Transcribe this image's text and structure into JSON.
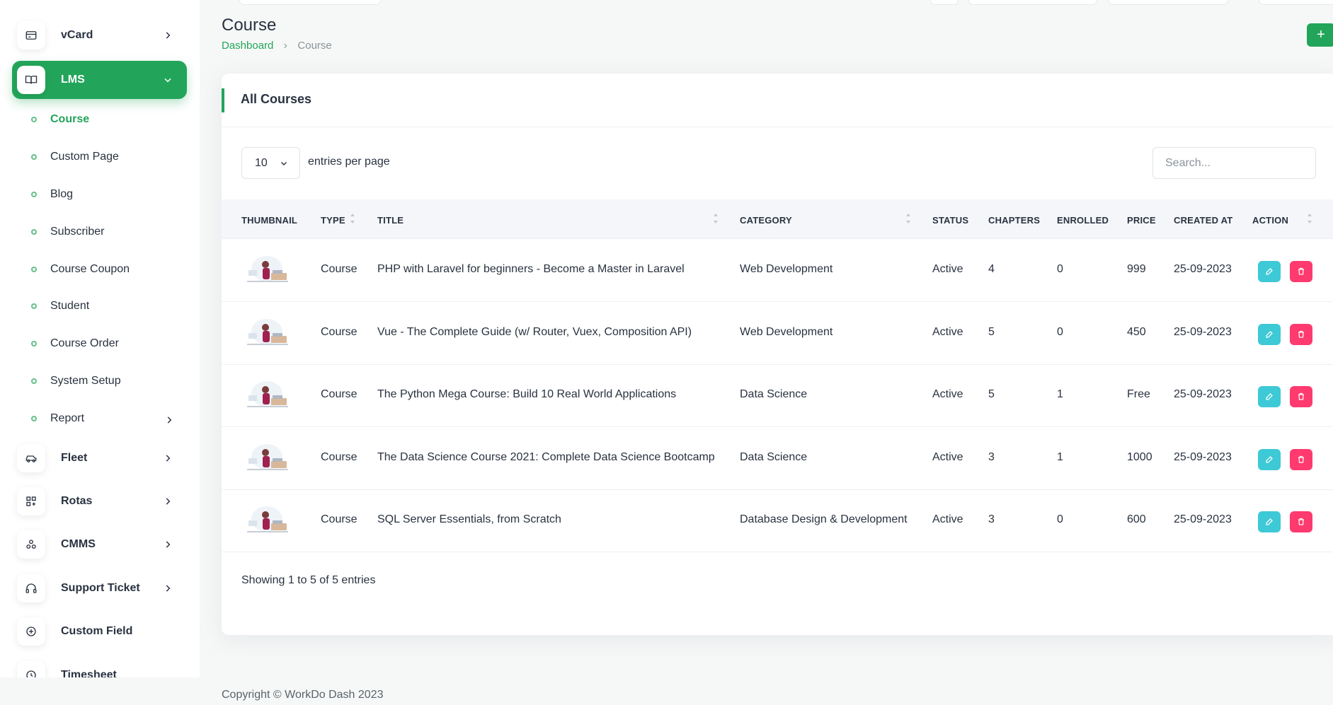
{
  "sidebar": {
    "items": [
      {
        "label": "vCard",
        "icon": "card-icon"
      },
      {
        "label": "LMS",
        "icon": "book-icon"
      },
      {
        "label": "Fleet",
        "icon": "car-icon"
      },
      {
        "label": "Rotas",
        "icon": "grid-plus-icon"
      },
      {
        "label": "CMMS",
        "icon": "nodes-icon"
      },
      {
        "label": "Support Ticket",
        "icon": "headset-icon"
      },
      {
        "label": "Custom Field",
        "icon": "plus-circle-icon"
      },
      {
        "label": "Timesheet",
        "icon": "clock-icon"
      }
    ],
    "lms_sub": [
      "Course",
      "Custom Page",
      "Blog",
      "Subscriber",
      "Course Coupon",
      "Student",
      "Course Order",
      "System Setup",
      "Report"
    ]
  },
  "header": {
    "title": "Course",
    "breadcrumb": [
      "Dashboard",
      "Course"
    ],
    "add_label": "+"
  },
  "card": {
    "title": "All Courses",
    "entries_value": "10",
    "entries_label": "entries per page",
    "search_placeholder": "Search...",
    "columns": [
      "THUMBNAIL",
      "TYPE",
      "TITLE",
      "CATEGORY",
      "STATUS",
      "CHAPTERS",
      "ENROLLED",
      "PRICE",
      "CREATED AT",
      "ACTION"
    ],
    "rows": [
      {
        "type": "Course",
        "title": "PHP with Laravel for beginners - Become a Master in Laravel",
        "category": "Web Development",
        "status": "Active",
        "chapters": "4",
        "enrolled": "0",
        "price": "999",
        "created": "25-09-2023"
      },
      {
        "type": "Course",
        "title": "Vue - The Complete Guide (w/ Router, Vuex, Composition API)",
        "category": "Web Development",
        "status": "Active",
        "chapters": "5",
        "enrolled": "0",
        "price": "450",
        "created": "25-09-2023"
      },
      {
        "type": "Course",
        "title": "The Python Mega Course: Build 10 Real World Applications",
        "category": "Data Science",
        "status": "Active",
        "chapters": "5",
        "enrolled": "1",
        "price": "Free",
        "created": "25-09-2023"
      },
      {
        "type": "Course",
        "title": "The Data Science Course 2021: Complete Data Science Bootcamp",
        "category": "Data Science",
        "status": "Active",
        "chapters": "3",
        "enrolled": "1",
        "price": "1000",
        "created": "25-09-2023"
      },
      {
        "type": "Course",
        "title": "SQL Server Essentials, from Scratch",
        "category": "Database Design & Development",
        "status": "Active",
        "chapters": "3",
        "enrolled": "0",
        "price": "600",
        "created": "25-09-2023"
      }
    ],
    "showing": "Showing 1 to 5 of 5 entries"
  },
  "footer": {
    "text": "Copyright © WorkDo Dash 2023"
  },
  "colors": {
    "accent": "#22a55a",
    "edit": "#3ec9d6",
    "delete": "#ff3a6e"
  }
}
